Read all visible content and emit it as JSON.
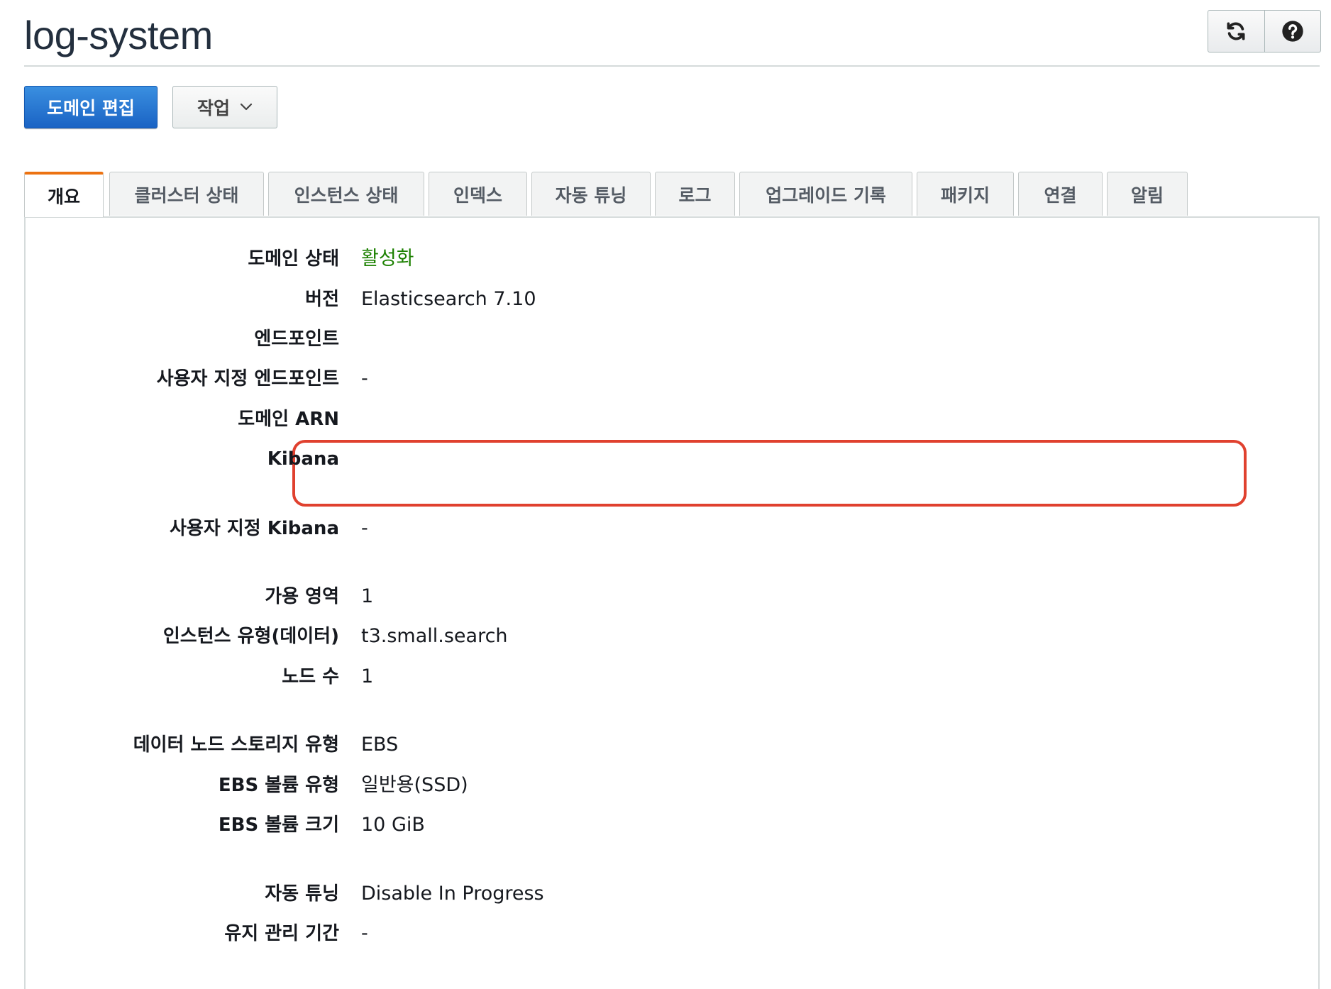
{
  "page": {
    "title": "log-system"
  },
  "toolbar": {
    "edit_domain": "도메인 편집",
    "actions": "작업",
    "refresh_icon": "refresh-icon",
    "help_icon": "help-icon"
  },
  "tabs": [
    {
      "label": "개요",
      "active": true
    },
    {
      "label": "클러스터 상태"
    },
    {
      "label": "인스턴스 상태"
    },
    {
      "label": "인덱스"
    },
    {
      "label": "자동 튜닝"
    },
    {
      "label": "로그"
    },
    {
      "label": "업그레이드 기록"
    },
    {
      "label": "패키지"
    },
    {
      "label": "연결"
    },
    {
      "label": "알림"
    }
  ],
  "overview": {
    "domain_status": {
      "label": "도메인 상태",
      "value": "활성화",
      "color": "#1d8102"
    },
    "version": {
      "label": "버전",
      "value": "Elasticsearch 7.10"
    },
    "endpoint": {
      "label": "엔드포인트",
      "value": ""
    },
    "custom_endpoint": {
      "label": "사용자 지정 엔드포인트",
      "value": "-"
    },
    "domain_arn": {
      "label": "도메인 ARN",
      "value": ""
    },
    "kibana": {
      "label": "Kibana",
      "value": ""
    },
    "custom_kibana": {
      "label": "사용자 지정 Kibana",
      "value": "-"
    },
    "availability_zones": {
      "label": "가용 영역",
      "value": "1"
    },
    "instance_type": {
      "label": "인스턴스 유형(데이터)",
      "value": "t3.small.search"
    },
    "node_count": {
      "label": "노드 수",
      "value": "1"
    },
    "storage_type": {
      "label": "데이터 노드 스토리지 유형",
      "value": "EBS"
    },
    "ebs_volume_type": {
      "label": "EBS 볼륨 유형",
      "value": "일반용(SSD)"
    },
    "ebs_volume_size": {
      "label": "EBS 볼륨 크기",
      "value": "10 GiB"
    },
    "auto_tune": {
      "label": "자동 튜닝",
      "value": "Disable In Progress"
    },
    "maintenance_window": {
      "label": "유지 관리 기간",
      "value": "-"
    }
  }
}
